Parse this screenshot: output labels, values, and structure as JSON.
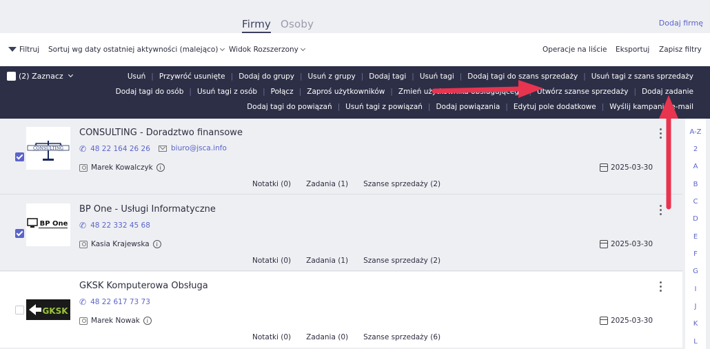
{
  "tabs": [
    {
      "label": "Firmy",
      "active": true
    },
    {
      "label": "Osoby",
      "active": false
    }
  ],
  "add_company_label": "Dodaj firmę",
  "filterbar": {
    "filter_label": "Filtruj",
    "sort_label": "Sortuj wg daty ostatniej aktywności (malejąco)",
    "view_label": "Widok Rozszerzony",
    "operations_label": "Operacje na liście",
    "export_label": "Eksportuj",
    "save_filters_label": "Zapisz filtry"
  },
  "actionbar": {
    "select_label": "(2) Zaznacz",
    "row1": [
      "Usuń",
      "Przywróć usunięte",
      "Dodaj do grupy",
      "Usuń z grupy",
      "Dodaj tagi",
      "Usuń tagi",
      "Dodaj tagi do szans sprzedaży",
      "Usuń tagi z szans sprzedaży"
    ],
    "row2": [
      "Dodaj tagi do osób",
      "Usuń tagi z osób",
      "Połącz",
      "Zaproś użytkowników",
      "Zmień użytkownika obsługującego",
      "Utwórz szanse sprzedaży",
      "Dodaj zadanie"
    ],
    "row3": [
      "Dodaj tagi do powiązań",
      "Usuń tagi z powiązań",
      "Dodaj powiązania",
      "Edytuj pole dodatkowe",
      "Wyślij kampanię e-mail"
    ]
  },
  "companies": [
    {
      "name": "CONSULTING - Doradztwo finansowe",
      "phone": "48 22 164 26 26",
      "email": "biuro@jsca.info",
      "owner": "Marek Kowalczyk",
      "date": "2025-03-30",
      "notes": "Notatki (0)",
      "tasks": "Zadania (1)",
      "opportunities": "Szanse sprzedaży (2)",
      "selected": true,
      "logo_text": "CONSULTING"
    },
    {
      "name": "BP One - Usługi Informatyczne",
      "phone": "48 22 332 45 68",
      "email": "",
      "owner": "Kasia Krajewska",
      "date": "2025-03-30",
      "notes": "Notatki (0)",
      "tasks": "Zadania (1)",
      "opportunities": "Szanse sprzedaży (2)",
      "selected": true,
      "logo_text": "BP One"
    },
    {
      "name": "GKSK Komputerowa Obsługa",
      "phone": "48 22 617 73 73",
      "email": "",
      "owner": "Marek Nowak",
      "date": "2025-03-30",
      "notes": "Notatki (0)",
      "tasks": "Zadania (0)",
      "opportunities": "Szanse sprzedaży (6)",
      "selected": false,
      "logo_text": "GKSK"
    }
  ],
  "alphabet": [
    "A-Z",
    "2",
    "A",
    "B",
    "C",
    "D",
    "E",
    "F",
    "G",
    "I",
    "J",
    "K",
    "L"
  ],
  "colors": {
    "accent": "#5b64c9",
    "dark_bar": "#2d2f47",
    "arrow": "#e8344f"
  }
}
